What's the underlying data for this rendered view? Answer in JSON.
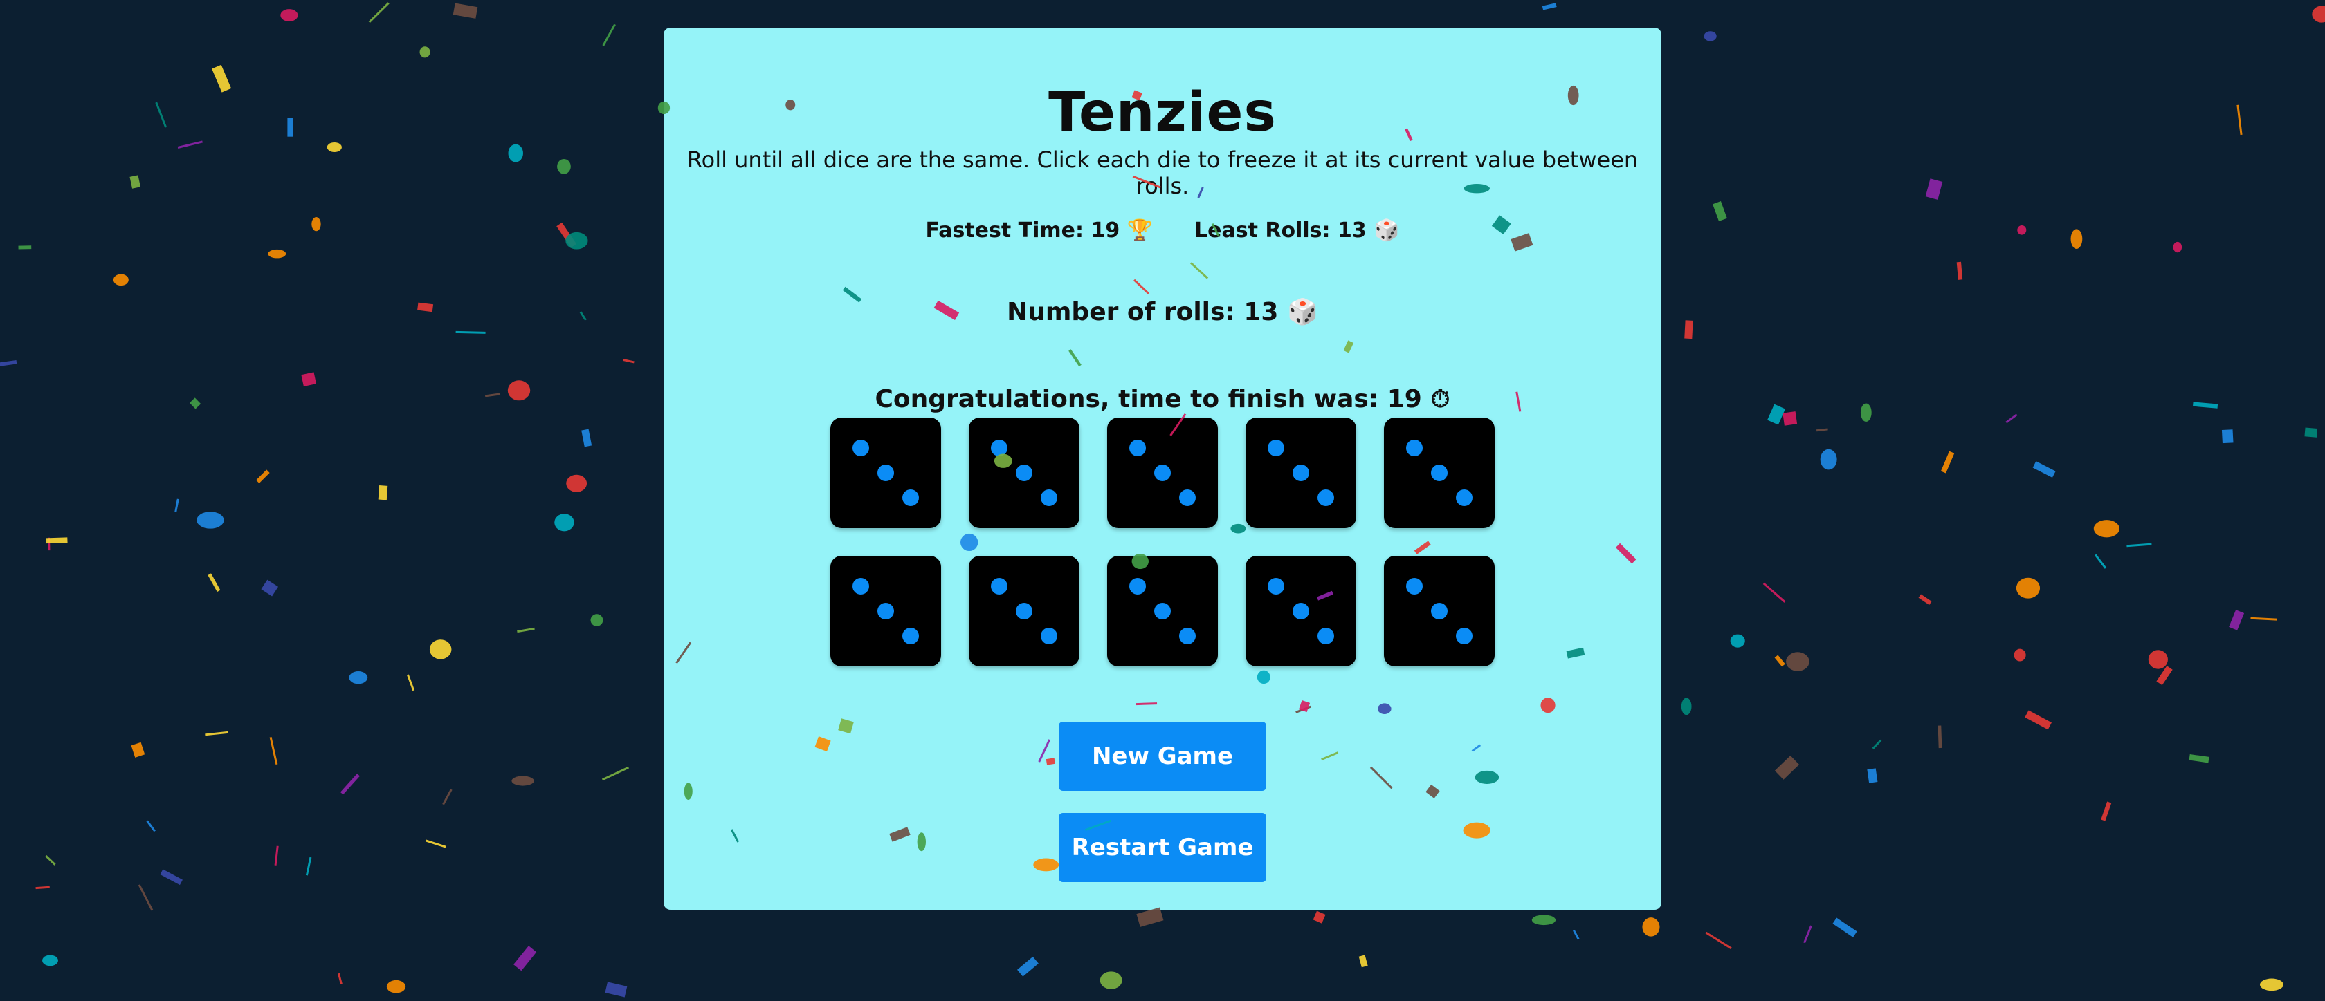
{
  "game": {
    "title": "Tenzies",
    "instructions": "Roll until all dice are the same. Click each die to freeze it at its current value between rolls.",
    "fastest_time_label": "Fastest Time: 19",
    "fastest_time_icon": "trophy-icon",
    "fastest_time_glyph": "🏆",
    "least_rolls_label": "Least Rolls: 13",
    "least_rolls_icon": "dice-icon",
    "least_rolls_glyph": "🎲",
    "rolls_label": "Number of rolls: 13",
    "rolls_icon": "dice-icon",
    "rolls_glyph": "🎲",
    "congrats_label": "Congratulations, time to finish was: 19",
    "congrats_icon": "stopwatch-icon",
    "congrats_glyph": "⏱"
  },
  "dice": [
    {
      "value": 3
    },
    {
      "value": 3
    },
    {
      "value": 3
    },
    {
      "value": 3
    },
    {
      "value": 3
    },
    {
      "value": 3
    },
    {
      "value": 3
    },
    {
      "value": 3
    },
    {
      "value": 3
    },
    {
      "value": 3
    }
  ],
  "buttons": {
    "new_game": "New Game",
    "restart_game": "Restart Game"
  },
  "colors": {
    "background": "#0c1f31",
    "panel": "#95f3f8",
    "die": "#000000",
    "pip": "#0b8cf5",
    "button": "#0b8cf5",
    "confetti": [
      "#e53935",
      "#43a047",
      "#1e88e5",
      "#fdd835",
      "#8e24aa",
      "#fb8c00",
      "#00acc1",
      "#3949ab",
      "#6d4c41",
      "#d81b60",
      "#7cb342",
      "#00897b"
    ]
  }
}
